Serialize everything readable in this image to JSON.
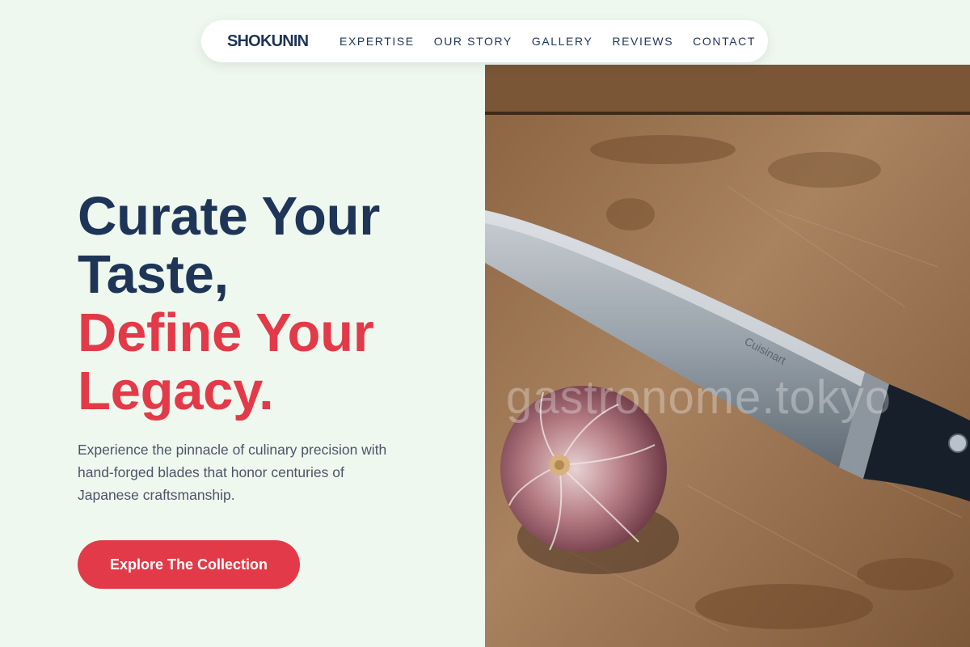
{
  "brand": "SHOKUNIN",
  "nav": {
    "links": [
      "EXPERTISE",
      "OUR STORY",
      "GALLERY",
      "REVIEWS",
      "CONTACT"
    ]
  },
  "hero": {
    "headline_line1": "Curate Your",
    "headline_line2": "Taste,",
    "headline_line3": "Define Your",
    "headline_line4": "Legacy.",
    "subtitle": "Experience the pinnacle of culinary precision with hand-forged blades that honor centuries of Japanese craftsmanship.",
    "cta_label": "Explore The Collection"
  },
  "image": {
    "watermark": "gastronome.tokyo",
    "knife_brand": "Cuisinart"
  },
  "colors": {
    "background": "#eff8ee",
    "navy": "#1e3558",
    "accent_red": "#e23a48"
  }
}
